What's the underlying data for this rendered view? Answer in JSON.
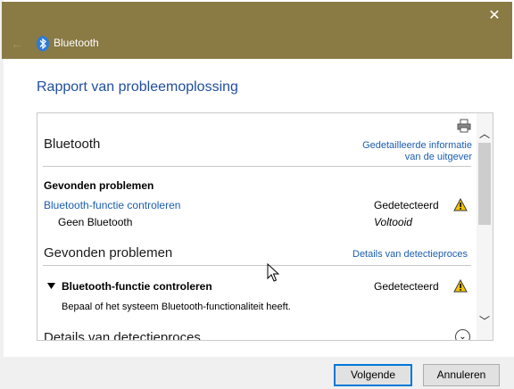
{
  "window": {
    "title": "Bluetooth",
    "close_glyph": "✕",
    "back_glyph": "←"
  },
  "heading": "Rapport van probleemoplossing",
  "report": {
    "section1": {
      "title": "Bluetooth",
      "publisher_link_line1": "Gedetailleerde informatie",
      "publisher_link_line2": "van de uitgever"
    },
    "found_problems_label": "Gevonden problemen",
    "problem_row": {
      "link": "Bluetooth-functie controleren",
      "status": "Gedetecteerd",
      "sub_label": "Geen Bluetooth",
      "sub_status": "Voltooid"
    },
    "section2": {
      "title": "Gevonden problemen",
      "detection_link": "Details van detectieproces"
    },
    "expanded_problem": {
      "label": "Bluetooth-functie controleren",
      "status": "Gedetecteerd",
      "description": "Bepaal of het systeem Bluetooth-functionaliteit heeft."
    },
    "section3": {
      "title": "Details van detectieproces"
    }
  },
  "buttons": {
    "next": "Volgende",
    "cancel": "Annuleren"
  },
  "colors": {
    "titlebar": "#8a7a44",
    "link": "#1b5eb0",
    "heading": "#1f4e9c",
    "warning": "#f2c200"
  },
  "icons": [
    "bluetooth-icon",
    "back-arrow-icon",
    "close-icon",
    "printer-icon",
    "warning-icon",
    "triangle-down-icon",
    "chevron-up-icon",
    "chevron-down-icon",
    "expand-circle-icon",
    "mouse-cursor-icon"
  ]
}
